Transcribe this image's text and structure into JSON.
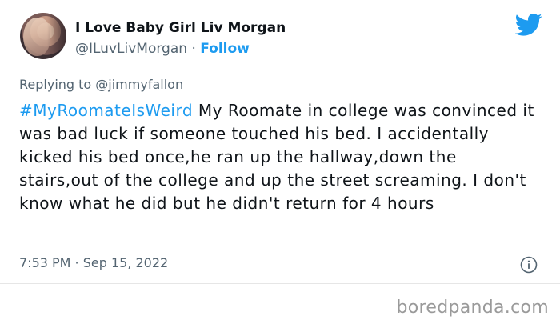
{
  "user": {
    "display_name": "I Love Baby Girl Liv Morgan",
    "handle": "@ILuvLivMorgan",
    "separator": "·",
    "follow_label": "Follow"
  },
  "reply": {
    "label": "Replying to @jimmyfallon"
  },
  "tweet": {
    "hashtag": "#MyRoomateIsWeird",
    "text": " My Roomate in college was convinced it was bad luck if someone touched his bed. I accidentally kicked his bed once,he ran up the hallway,down the stairs,out of the college and up the street screaming. I don't know what he did but he didn't return for 4 hours"
  },
  "meta": {
    "timestamp": "7:53 PM · Sep 15, 2022"
  },
  "watermark": "boredpanda.com",
  "colors": {
    "accent": "#1d9bf0",
    "text": "#0f1419",
    "secondary": "#536471"
  },
  "icons": {
    "brand": "twitter-bird-icon",
    "info": "info-icon"
  }
}
